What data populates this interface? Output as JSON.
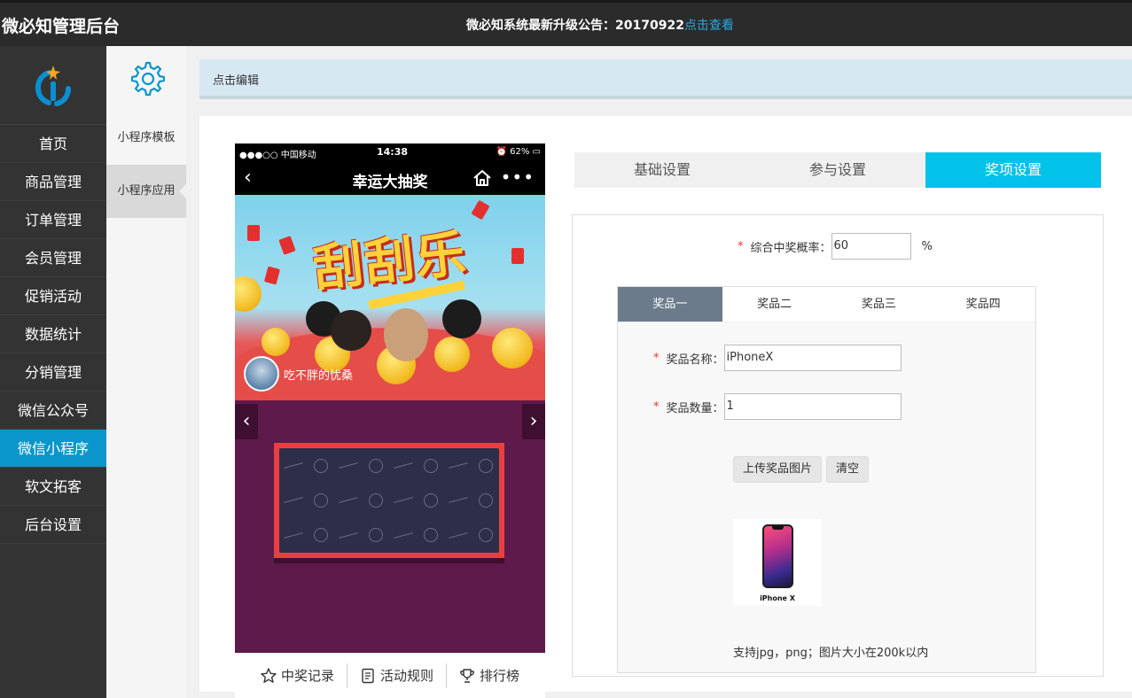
{
  "header": {
    "brand": "微必知管理后台",
    "notice_text": "微必知系统最新升级公告：20170922",
    "notice_link": "点击查看"
  },
  "sidebar": {
    "items": [
      {
        "label": "首页"
      },
      {
        "label": "商品管理"
      },
      {
        "label": "订单管理"
      },
      {
        "label": "会员管理"
      },
      {
        "label": "促销活动"
      },
      {
        "label": "数据统计"
      },
      {
        "label": "分销管理"
      },
      {
        "label": "微信公众号"
      },
      {
        "label": "微信小程序",
        "active": true
      },
      {
        "label": "软文拓客"
      },
      {
        "label": "后台设置"
      }
    ]
  },
  "subnav": {
    "items": [
      {
        "label": "小程序模板"
      },
      {
        "label": "小程序应用",
        "active": true
      }
    ]
  },
  "editbar": {
    "label": "点击编辑"
  },
  "phone": {
    "carrier": "●●●○○ 中国移动",
    "time": "14:38",
    "battery": "62%",
    "title": "幸运大抽奖",
    "headline": "刮刮乐",
    "user_name": "吃不胖的忧桑",
    "footer": {
      "records": "中奖记录",
      "rules": "活动规则",
      "ranking": "排行榜"
    }
  },
  "tabs": {
    "basic": "基础设置",
    "join": "参与设置",
    "prize": "奖项设置"
  },
  "form": {
    "rate_label": "综合中奖概率：",
    "rate_value": "60",
    "rate_unit": "%",
    "prize_tabs": [
      "奖品一",
      "奖品二",
      "奖品三",
      "奖品四"
    ],
    "name_label": "奖品名称：",
    "name_value": "iPhoneX",
    "qty_label": "奖品数量：",
    "qty_value": "1",
    "upload_label": "上传奖品图片",
    "clear_label": "清空",
    "image_caption": "iPhone X",
    "hint": "支持jpg，png；图片大小在200k以内"
  },
  "colors": {
    "accent": "#02c2ea",
    "nav_active": "#0a96cb",
    "required": "#e33"
  }
}
